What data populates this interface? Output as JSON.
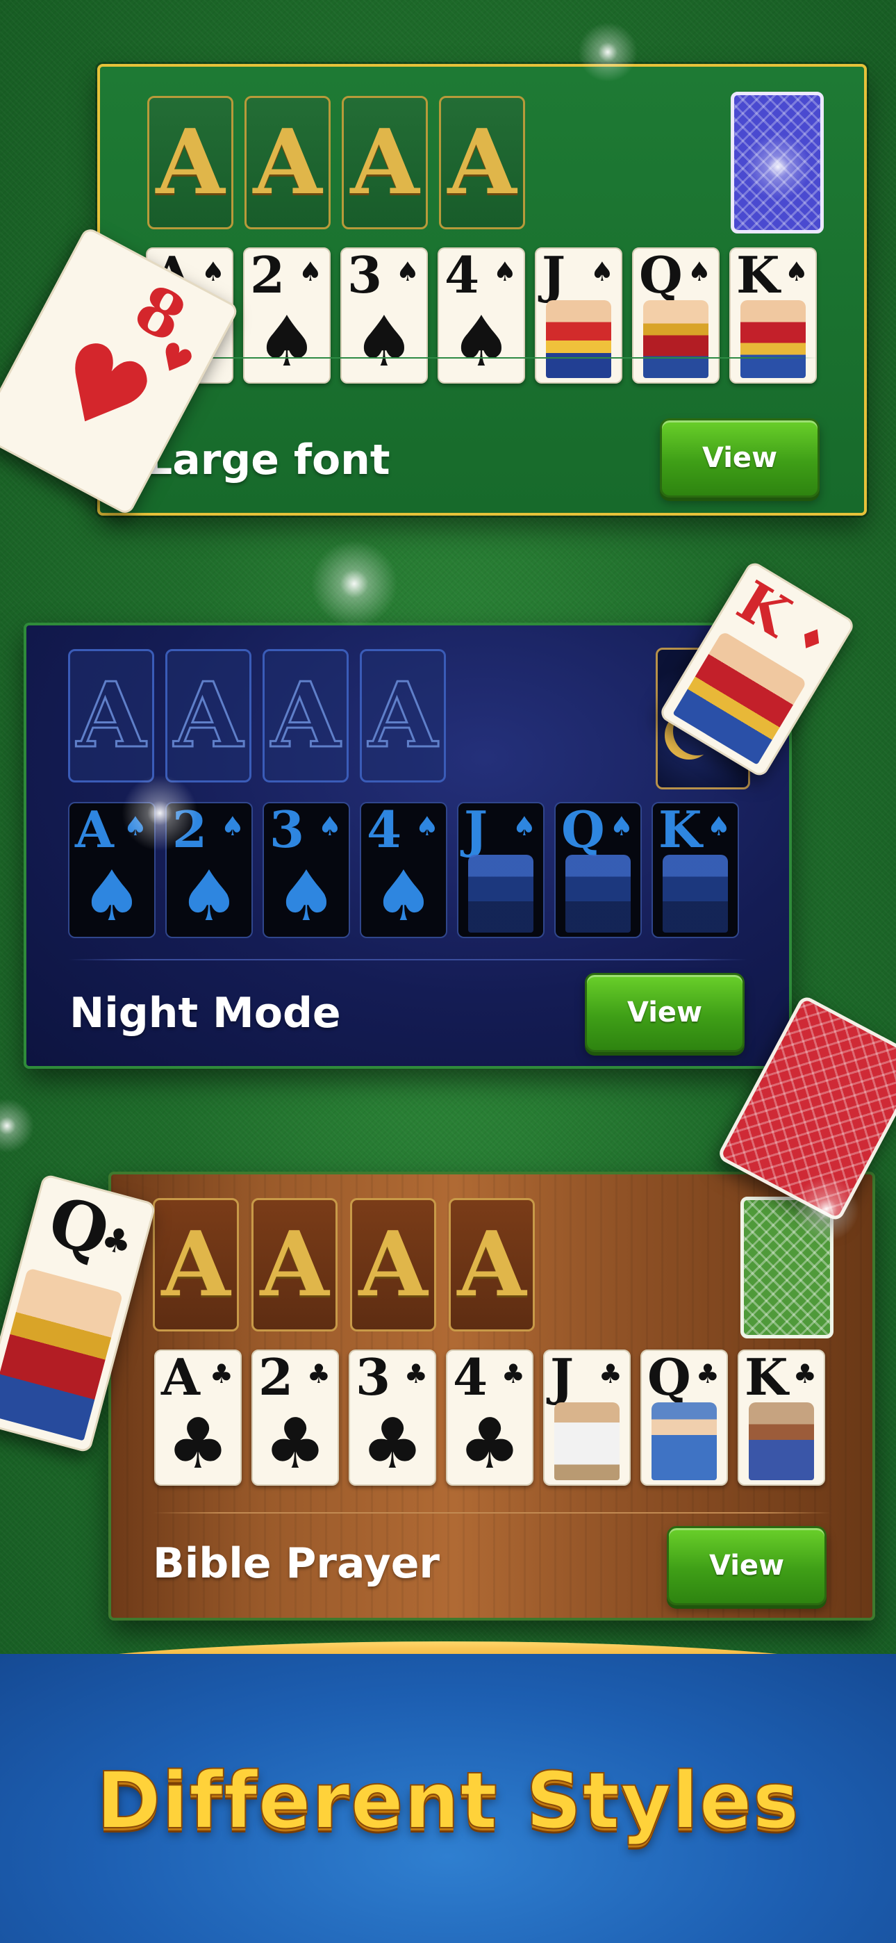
{
  "styles": [
    {
      "id": "large-font",
      "title": "Large font",
      "button": "View",
      "foundation_letters": [
        "A",
        "A",
        "A",
        "A"
      ],
      "cards": [
        {
          "rank": "A",
          "suit": "♠",
          "face": ""
        },
        {
          "rank": "2",
          "suit": "♠",
          "face": ""
        },
        {
          "rank": "3",
          "suit": "♠",
          "face": ""
        },
        {
          "rank": "4",
          "suit": "♠",
          "face": ""
        },
        {
          "rank": "J",
          "suit": "♠",
          "face": "jack"
        },
        {
          "rank": "Q",
          "suit": "♠",
          "face": "queen"
        },
        {
          "rank": "K",
          "suit": "♠",
          "face": "king"
        }
      ]
    },
    {
      "id": "night-mode",
      "title": "Night Mode",
      "button": "View",
      "foundation_letters": [
        "A",
        "A",
        "A",
        "A"
      ],
      "cards": [
        {
          "rank": "A",
          "suit": "♠",
          "face": ""
        },
        {
          "rank": "2",
          "suit": "♠",
          "face": ""
        },
        {
          "rank": "3",
          "suit": "♠",
          "face": ""
        },
        {
          "rank": "4",
          "suit": "♠",
          "face": ""
        },
        {
          "rank": "J",
          "suit": "♠",
          "face": "night"
        },
        {
          "rank": "Q",
          "suit": "♠",
          "face": "night"
        },
        {
          "rank": "K",
          "suit": "♠",
          "face": "night"
        }
      ]
    },
    {
      "id": "bible-prayer",
      "title": "Bible Prayer",
      "button": "View",
      "foundation_letters": [
        "A",
        "A",
        "A",
        "A"
      ],
      "cards": [
        {
          "rank": "A",
          "suit": "♣",
          "face": ""
        },
        {
          "rank": "2",
          "suit": "♣",
          "face": ""
        },
        {
          "rank": "3",
          "suit": "♣",
          "face": ""
        },
        {
          "rank": "4",
          "suit": "♣",
          "face": ""
        },
        {
          "rank": "J",
          "suit": "♣",
          "face": "bible-j"
        },
        {
          "rank": "Q",
          "suit": "♣",
          "face": "bible-q"
        },
        {
          "rank": "K",
          "suit": "♣",
          "face": "bible-k"
        }
      ]
    }
  ],
  "floating_cards": {
    "eight_hearts": {
      "rank": "8",
      "suit": "♥"
    },
    "king_diamonds": {
      "rank": "K",
      "suit": "♦"
    },
    "queen_clubs": {
      "rank": "Q",
      "suit": "♣"
    }
  },
  "headline": "Different Styles",
  "colors": {
    "table_green": "#1f6d2b",
    "panel_border_gold": "#e6c23a",
    "night_panel": "#141c54",
    "wood_panel": "#9a5a2a",
    "view_button_green": "#3f9f17",
    "headline_yellow": "#ffd23a",
    "bottom_blue": "#1d5fb2"
  }
}
